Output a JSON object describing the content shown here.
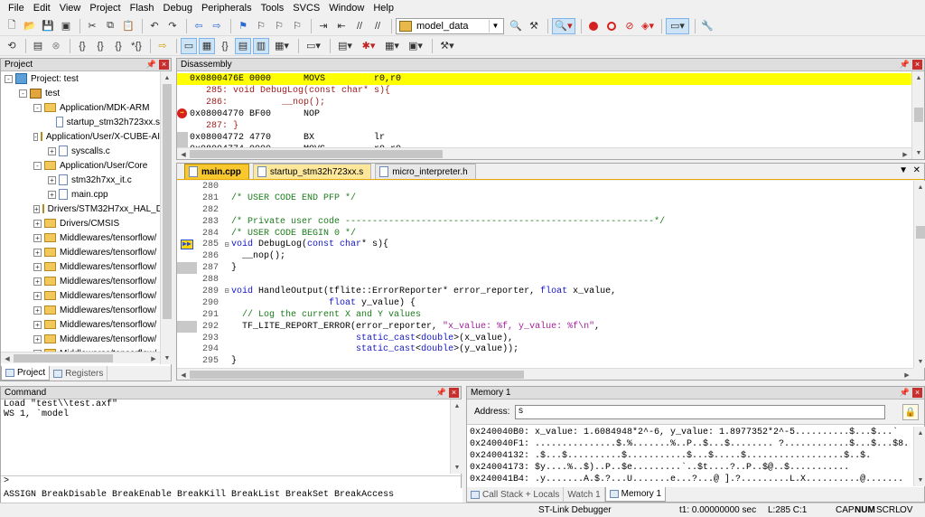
{
  "menu": [
    "File",
    "Edit",
    "View",
    "Project",
    "Flash",
    "Debug",
    "Peripherals",
    "Tools",
    "SVCS",
    "Window",
    "Help"
  ],
  "toolbar": {
    "target_combo": "model_data"
  },
  "project_panel": {
    "title": "Project",
    "tree": [
      {
        "label": "Project: test",
        "indent": 0,
        "exp": "-",
        "icon": "project"
      },
      {
        "label": "test",
        "indent": 1,
        "exp": "-",
        "icon": "target"
      },
      {
        "label": "Application/MDK-ARM",
        "indent": 2,
        "exp": "-",
        "icon": "folder"
      },
      {
        "label": "startup_stm32h723xx.s",
        "indent": 3,
        "exp": "",
        "icon": "file"
      },
      {
        "label": "Application/User/X-CUBE-AI",
        "indent": 2,
        "exp": "-",
        "icon": "folder"
      },
      {
        "label": "syscalls.c",
        "indent": 3,
        "exp": "+",
        "icon": "file"
      },
      {
        "label": "Application/User/Core",
        "indent": 2,
        "exp": "-",
        "icon": "folder"
      },
      {
        "label": "stm32h7xx_it.c",
        "indent": 3,
        "exp": "+",
        "icon": "file"
      },
      {
        "label": "main.cpp",
        "indent": 3,
        "exp": "+",
        "icon": "file"
      },
      {
        "label": "Drivers/STM32H7xx_HAL_Driver",
        "indent": 2,
        "exp": "+",
        "icon": "folder"
      },
      {
        "label": "Drivers/CMSIS",
        "indent": 2,
        "exp": "+",
        "icon": "folder"
      },
      {
        "label": "Middlewares/tensorflow/",
        "indent": 2,
        "exp": "+",
        "icon": "folder"
      },
      {
        "label": "Middlewares/tensorflow/",
        "indent": 2,
        "exp": "+",
        "icon": "folder"
      },
      {
        "label": "Middlewares/tensorflow/",
        "indent": 2,
        "exp": "+",
        "icon": "folder"
      },
      {
        "label": "Middlewares/tensorflow/",
        "indent": 2,
        "exp": "+",
        "icon": "folder"
      },
      {
        "label": "Middlewares/tensorflow/",
        "indent": 2,
        "exp": "+",
        "icon": "folder"
      },
      {
        "label": "Middlewares/tensorflow/",
        "indent": 2,
        "exp": "+",
        "icon": "folder"
      },
      {
        "label": "Middlewares/tensorflow/",
        "indent": 2,
        "exp": "+",
        "icon": "folder"
      },
      {
        "label": "Middlewares/tensorflow/",
        "indent": 2,
        "exp": "+",
        "icon": "folder"
      },
      {
        "label": "Middlewares/tensorflow/",
        "indent": 2,
        "exp": "+",
        "icon": "folder"
      }
    ],
    "tabs": [
      "Project",
      "Registers"
    ]
  },
  "disassembly": {
    "title": "Disassembly",
    "rows": [
      {
        "text": "0x0800476E 0000      MOVS         r0,r0",
        "highlight": true,
        "gutter": false
      },
      {
        "text": "   285: void DebugLog(const char* s){",
        "highlight": false,
        "gutter": false,
        "color": "#a01e1e"
      },
      {
        "text": "   286:          __nop();",
        "highlight": false,
        "gutter": false,
        "color": "#a01e1e"
      },
      {
        "text": "0x08004770 BF00      NOP",
        "highlight": false,
        "gutter": true,
        "arrow": true
      },
      {
        "text": "   287: }",
        "highlight": false,
        "gutter": false,
        "color": "#a01e1e"
      },
      {
        "text": "0x08004772 4770      BX           lr",
        "highlight": false,
        "gutter": true
      },
      {
        "text": "0x08004774 0000      MOVS         r0,r0",
        "highlight": false,
        "gutter": true
      }
    ]
  },
  "editor": {
    "tabs": [
      "main.cpp",
      "startup_stm32h723xx.s",
      "micro_interpreter.h"
    ],
    "lines": [
      {
        "n": "280",
        "fold": "",
        "html": ""
      },
      {
        "n": "281",
        "fold": "",
        "html": "<span class='cm'>/* USER CODE END PFP */</span>"
      },
      {
        "n": "282",
        "fold": "",
        "html": ""
      },
      {
        "n": "283",
        "fold": "",
        "html": "<span class='cm'>/* Private user code ---------------------------------------------------------*/</span>"
      },
      {
        "n": "284",
        "fold": "",
        "html": "<span class='cm'>/* USER CODE BEGIN 0 */</span>"
      },
      {
        "n": "285",
        "fold": "⊟",
        "html": "<span class='kw'>void</span> DebugLog(<span class='kw'>const char</span>* s){",
        "arrow": true
      },
      {
        "n": "286",
        "fold": "",
        "html": "  __nop();"
      },
      {
        "n": "287",
        "fold": "",
        "html": "}",
        "gutter": true
      },
      {
        "n": "288",
        "fold": "",
        "html": ""
      },
      {
        "n": "289",
        "fold": "⊟",
        "html": "<span class='kw'>void</span> HandleOutput(tflite::ErrorReporter* error_reporter, <span class='kw'>float</span> x_value,"
      },
      {
        "n": "290",
        "fold": "",
        "html": "                  <span class='kw'>float</span> y_value) {"
      },
      {
        "n": "291",
        "fold": "",
        "html": "  <span class='cm'>// Log the current X and Y values</span>"
      },
      {
        "n": "292",
        "fold": "",
        "html": "  TF_LITE_REPORT_ERROR(error_reporter, <span class='st'>\"x_value: %f, y_value: %f\\n\"</span>,",
        "gutter": true
      },
      {
        "n": "293",
        "fold": "",
        "html": "                       <span class='kw'>static_cast</span>&lt;<span class='kw'>double</span>&gt;(x_value),"
      },
      {
        "n": "294",
        "fold": "",
        "html": "                       <span class='kw'>static_cast</span>&lt;<span class='kw'>double</span>&gt;(y_value));"
      },
      {
        "n": "295",
        "fold": "",
        "html": "}"
      }
    ]
  },
  "command": {
    "title": "Command",
    "output": [
      "Load \"test\\\\test.axf\"",
      "WS 1, `model"
    ],
    "prompt": ">",
    "help": "ASSIGN BreakDisable BreakEnable BreakKill BreakList BreakSet BreakAccess"
  },
  "memory": {
    "title": "Memory 1",
    "address_label": "Address:",
    "address_value": "s",
    "rows": [
      "0x240040B0: x_value: 1.6084948*2^-6, y_value: 1.8977352*2^-5..........$...$...`",
      "0x240040F1: ...............$.%.......%..P..$...$........ ?............$...$...$8.",
      "0x24004132: .$...$..........$...........$...$.....$..................$..$.",
      "0x24004173: $y....%..$)..P..$e.........`..$t....?..P..$@..$...........",
      "0x240041B4: .y.......A.$.?...U.......e...?...@ ].?.........L.X..........@......."
    ],
    "tabs": [
      "Call Stack + Locals",
      "Watch 1",
      "Memory 1"
    ]
  },
  "status": {
    "debugger": "ST-Link Debugger",
    "time": "t1: 0.00000000 sec",
    "position": "L:285 C:1",
    "caps": "CAP",
    "num": "NUM",
    "scrl": "SCRL",
    "ovr": "OV"
  }
}
